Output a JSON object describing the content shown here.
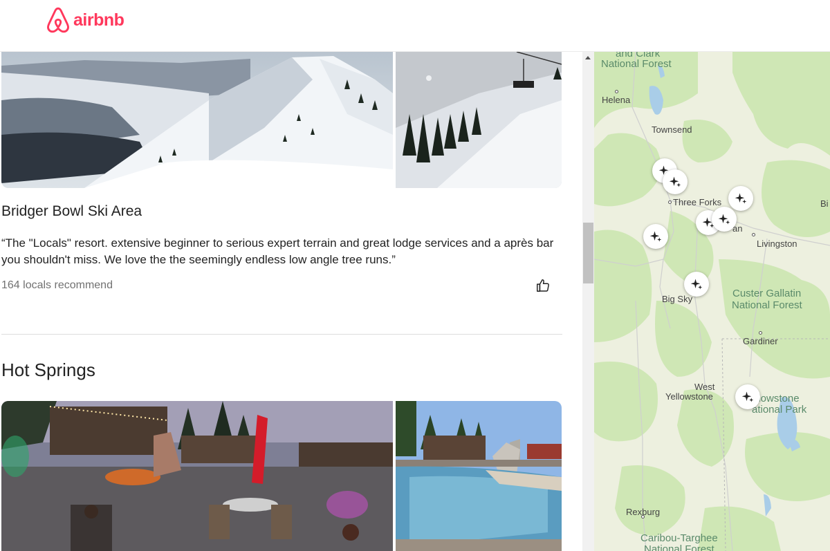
{
  "brand": {
    "name": "airbnb",
    "color": "#ff385c"
  },
  "place": {
    "title": "Bridger Bowl Ski Area",
    "quote": "“The \"Locals\" resort. extensive beginner to serious expert terrain and great lodge services and a après bar you shouldn't miss. We love the the seemingly endless low angle tree runs.”",
    "recommend": "164 locals recommend",
    "like_icon": "thumbs-up-icon"
  },
  "section": {
    "title": "Hot Springs"
  },
  "map": {
    "labels": {
      "forest_top_1": "and Clark",
      "forest_top_2": "National Forest",
      "helena": "Helena",
      "townsend": "Townsend",
      "three_forks": "Three Forks",
      "bi": "Bi",
      "bozeman_partial": "an",
      "livingston": "Livingston",
      "big_sky": "Big Sky",
      "custer_1": "Custer Gallatin",
      "custer_2": "National Forest",
      "gardiner": "Gardiner",
      "west": "West",
      "yellowstone": "Yellowstone",
      "ynp_1": "llowstone",
      "ynp_2": "ational Park",
      "rexburg": "Rexburg",
      "caribou_1": "Caribou-Targhee",
      "caribou_2": "National Forest"
    },
    "pin_icon": "sparkle-icon",
    "pin_count": 8
  }
}
